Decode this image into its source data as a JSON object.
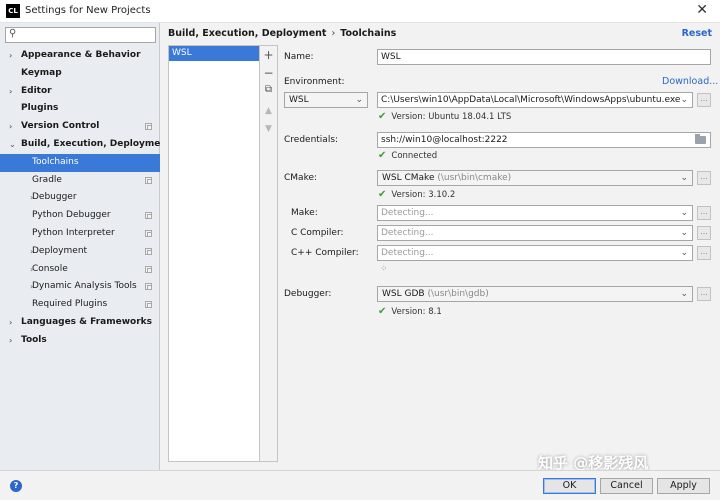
{
  "window": {
    "app_icon": "CL",
    "title": "Settings for New Projects",
    "close": "✕"
  },
  "sidebar": {
    "search_placeholder": "",
    "items": [
      {
        "label": "Appearance & Behavior",
        "bold": true,
        "arrow": "›",
        "level": 0
      },
      {
        "label": "Keymap",
        "bold": true,
        "arrow": "",
        "level": 0
      },
      {
        "label": "Editor",
        "bold": true,
        "arrow": "›",
        "level": 0
      },
      {
        "label": "Plugins",
        "bold": true,
        "arrow": "",
        "level": 0
      },
      {
        "label": "Version Control",
        "bold": true,
        "arrow": "›",
        "level": 0,
        "project": true
      },
      {
        "label": "Build, Execution, Deployment",
        "bold": true,
        "arrow": "⌄",
        "level": 0
      },
      {
        "label": "Toolchains",
        "bold": false,
        "arrow": "",
        "level": 1,
        "selected": true
      },
      {
        "label": "Gradle",
        "bold": false,
        "arrow": "",
        "level": 1,
        "project": true
      },
      {
        "label": "Debugger",
        "bold": false,
        "arrow": "›",
        "level": 1
      },
      {
        "label": "Python Debugger",
        "bold": false,
        "arrow": "",
        "level": 1,
        "project": true
      },
      {
        "label": "Python Interpreter",
        "bold": false,
        "arrow": "",
        "level": 1,
        "project": true
      },
      {
        "label": "Deployment",
        "bold": false,
        "arrow": "›",
        "level": 1,
        "project": true
      },
      {
        "label": "Console",
        "bold": false,
        "arrow": "›",
        "level": 1,
        "project": true
      },
      {
        "label": "Dynamic Analysis Tools",
        "bold": false,
        "arrow": "›",
        "level": 1,
        "project": true
      },
      {
        "label": "Required Plugins",
        "bold": false,
        "arrow": "",
        "level": 1,
        "project": true
      },
      {
        "label": "Languages & Frameworks",
        "bold": true,
        "arrow": "›",
        "level": 0
      },
      {
        "label": "Tools",
        "bold": true,
        "arrow": "›",
        "level": 0
      }
    ]
  },
  "breadcrumb": {
    "parent": "Build, Execution, Deployment",
    "separator": "›",
    "current": "Toolchains",
    "reset": "Reset"
  },
  "toolchains": {
    "items": [
      "WSL"
    ],
    "tools": {
      "add": "+",
      "remove": "−",
      "copy": "⧉",
      "up": "▲",
      "down": "▼"
    }
  },
  "form": {
    "name_label": "Name:",
    "name_value": "WSL",
    "environment_label": "Environment:",
    "download_link": "Download...",
    "environment_value": "WSL",
    "exe_path": "C:\\Users\\win10\\AppData\\Local\\Microsoft\\WindowsApps\\ubuntu.exe",
    "env_status": "Version: Ubuntu 18.04.1 LTS",
    "credentials_label": "Credentials:",
    "credentials_value": "ssh://win10@localhost:2222",
    "credentials_status": "Connected",
    "cmake_label": "CMake:",
    "cmake_name": "WSL CMake",
    "cmake_path": "(\\usr\\bin\\cmake)",
    "cmake_status": "Version: 3.10.2",
    "make_label": "Make:",
    "make_value": "Detecting...",
    "c_label": "C Compiler:",
    "c_value": "Detecting...",
    "cpp_label": "C++ Compiler:",
    "cpp_value": "Detecting...",
    "debugger_label": "Debugger:",
    "debugger_name": "WSL GDB",
    "debugger_path": "(\\usr\\bin\\gdb)",
    "debugger_status": "Version: 8.1",
    "browse": "...",
    "check": "✔",
    "caret": "⌄",
    "spinner": "⁘"
  },
  "buttons": {
    "help": "?",
    "ok": "OK",
    "cancel": "Cancel",
    "apply": "Apply"
  },
  "watermark": "知乎 @移影残风",
  "colors": {
    "accent": "#3a79d7",
    "link": "#2a67c8",
    "success": "#3f9a3f"
  }
}
